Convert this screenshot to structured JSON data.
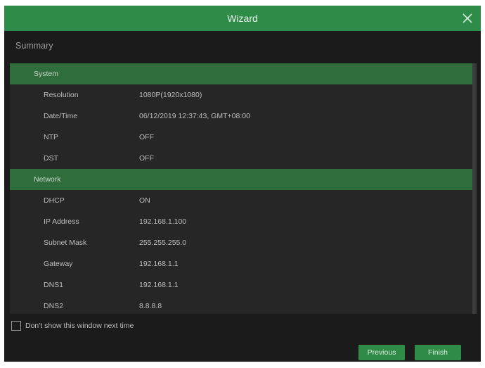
{
  "window": {
    "title": "Wizard"
  },
  "summary": {
    "label": "Summary"
  },
  "groups": {
    "system": {
      "title": "System",
      "rows": [
        {
          "label": "Resolution",
          "value": "1080P(1920x1080)"
        },
        {
          "label": "Date/Time",
          "value": "06/12/2019 12:37:43, GMT+08:00"
        },
        {
          "label": "NTP",
          "value": "OFF"
        },
        {
          "label": "DST",
          "value": "OFF"
        }
      ]
    },
    "network": {
      "title": "Network",
      "rows": [
        {
          "label": "DHCP",
          "value": "ON"
        },
        {
          "label": "IP Address",
          "value": "192.168.1.100"
        },
        {
          "label": "Subnet Mask",
          "value": "255.255.255.0"
        },
        {
          "label": "Gateway",
          "value": "192.168.1.1"
        },
        {
          "label": "DNS1",
          "value": "192.168.1.1"
        },
        {
          "label": "DNS2",
          "value": "8.8.8.8"
        }
      ]
    }
  },
  "footer": {
    "checkbox_label": "Don't show this window next time",
    "previous_label": "Previous",
    "finish_label": "Finish"
  },
  "colors": {
    "accent": "#2e8b48",
    "group_header": "#2f6d3c",
    "background": "#1b1b1b",
    "panel": "#262626"
  }
}
